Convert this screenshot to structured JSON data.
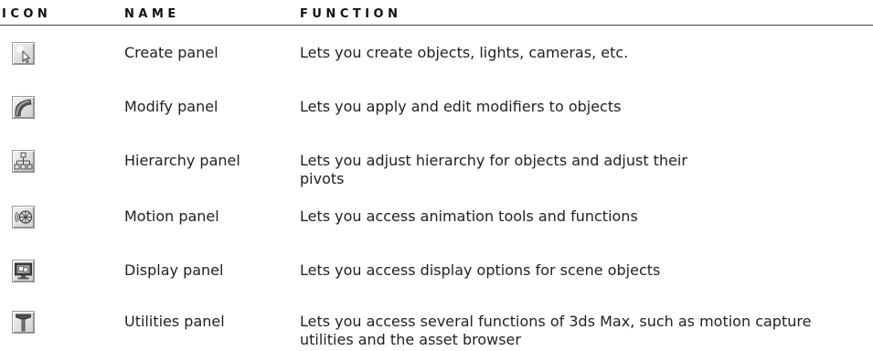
{
  "headers": {
    "icon": "ICON",
    "name": "NAME",
    "function": "FUNCTION"
  },
  "rows": [
    {
      "icon": "create-wand-icon",
      "name": "Create panel",
      "function": "Lets you create objects, lights, cameras, etc."
    },
    {
      "icon": "modify-arc-icon",
      "name": "Modify panel",
      "function": "Lets you apply and edit modifiers to objects"
    },
    {
      "icon": "hierarchy-tree-icon",
      "name": "Hierarchy panel",
      "function": "Lets you adjust hierarchy for objects and adjust their\npivots"
    },
    {
      "icon": "motion-wheel-icon",
      "name": "Motion panel",
      "function": "Lets you access animation tools and functions"
    },
    {
      "icon": "display-monitor-icon",
      "name": "Display panel",
      "function": "Lets you access display options for scene objects"
    },
    {
      "icon": "utilities-hammer-icon",
      "name": "Utilities panel",
      "function": "Lets you access several functions of 3ds Max, such as motion capture\nutilities and the asset browser"
    }
  ]
}
